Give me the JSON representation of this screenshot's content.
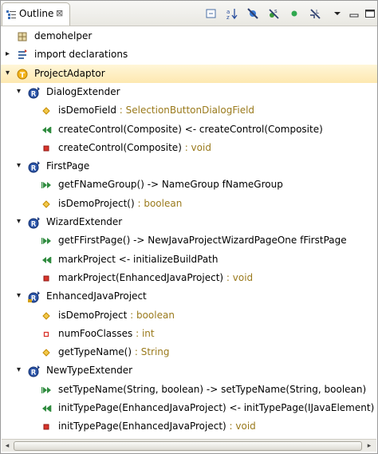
{
  "tab": {
    "title": "Outline",
    "close_glyph": "⊠"
  },
  "toolbar": [
    {
      "name": "collapse-all-icon"
    },
    {
      "name": "sort-az-icon"
    },
    {
      "name": "hide-fields-icon"
    },
    {
      "name": "hide-static-icon"
    },
    {
      "name": "hide-nonpublic-icon"
    },
    {
      "name": "hide-local-types-icon"
    },
    {
      "name": "view-menu-icon"
    },
    {
      "name": "minimize-icon"
    },
    {
      "name": "maximize-icon"
    }
  ],
  "tree": [
    {
      "name": "demohelper",
      "type": "",
      "icon": "package-icon",
      "twisty": "",
      "depth": 0
    },
    {
      "name": "import declarations",
      "type": "",
      "icon": "imports-icon",
      "twisty": "collapsed",
      "depth": 0
    },
    {
      "name": "ProjectAdaptor",
      "type": "",
      "icon": "aspect-icon",
      "twisty": "expanded",
      "depth": 0,
      "selected": true
    },
    {
      "name": "DialogExtender",
      "type": "",
      "icon": "role-icon",
      "twisty": "expanded",
      "depth": 1
    },
    {
      "name": "isDemoField",
      "type": " : SelectionButtonDialogField",
      "icon": "field-diamond-icon",
      "twisty": "",
      "depth": 2
    },
    {
      "name": "createControl(Composite) <- createControl(Composite)",
      "type": "",
      "icon": "callin-icon",
      "twisty": "",
      "depth": 2
    },
    {
      "name": "createControl(Composite)",
      "type": " : void",
      "icon": "private-method-icon",
      "twisty": "",
      "depth": 2
    },
    {
      "name": "FirstPage",
      "type": "",
      "icon": "role-icon",
      "twisty": "expanded",
      "depth": 1
    },
    {
      "name": "getFNameGroup() -> NameGroup fNameGroup",
      "type": "",
      "icon": "callout-icon",
      "twisty": "",
      "depth": 2
    },
    {
      "name": "isDemoProject()",
      "type": " : boolean",
      "icon": "field-diamond-icon",
      "twisty": "",
      "depth": 2
    },
    {
      "name": "WizardExtender",
      "type": "",
      "icon": "role-icon",
      "twisty": "expanded",
      "depth": 1
    },
    {
      "name": "getFFirstPage() -> NewJavaProjectWizardPageOne fFirstPage",
      "type": "",
      "icon": "callout-icon",
      "twisty": "",
      "depth": 2
    },
    {
      "name": "markProject <- initializeBuildPath",
      "type": "",
      "icon": "callin-icon",
      "twisty": "",
      "depth": 2
    },
    {
      "name": "markProject(EnhancedJavaProject)",
      "type": " : void",
      "icon": "private-method-icon",
      "twisty": "",
      "depth": 2
    },
    {
      "name": "EnhancedJavaProject",
      "type": "",
      "icon": "role-bound-icon",
      "twisty": "expanded",
      "depth": 1
    },
    {
      "name": "isDemoProject",
      "type": " : boolean",
      "icon": "field-diamond-icon",
      "twisty": "",
      "depth": 2
    },
    {
      "name": "numFooClasses",
      "type": " : int",
      "icon": "private-field-icon",
      "twisty": "",
      "depth": 2
    },
    {
      "name": "getTypeName()",
      "type": " : String",
      "icon": "field-diamond-icon",
      "twisty": "",
      "depth": 2
    },
    {
      "name": "NewTypeExtender",
      "type": "",
      "icon": "role-icon",
      "twisty": "expanded",
      "depth": 1
    },
    {
      "name": "setTypeName(String, boolean) -> setTypeName(String, boolean)",
      "type": "",
      "icon": "callout-icon",
      "twisty": "",
      "depth": 2
    },
    {
      "name": "initTypePage(EnhancedJavaProject) <- initTypePage(IJavaElement)",
      "type": "",
      "icon": "callin-icon",
      "twisty": "",
      "depth": 2
    },
    {
      "name": "initTypePage(EnhancedJavaProject)",
      "type": " : void",
      "icon": "private-method-icon",
      "twisty": "",
      "depth": 2
    }
  ],
  "scrollbar": {
    "left_arrow": "◂",
    "right_arrow": "▸"
  }
}
